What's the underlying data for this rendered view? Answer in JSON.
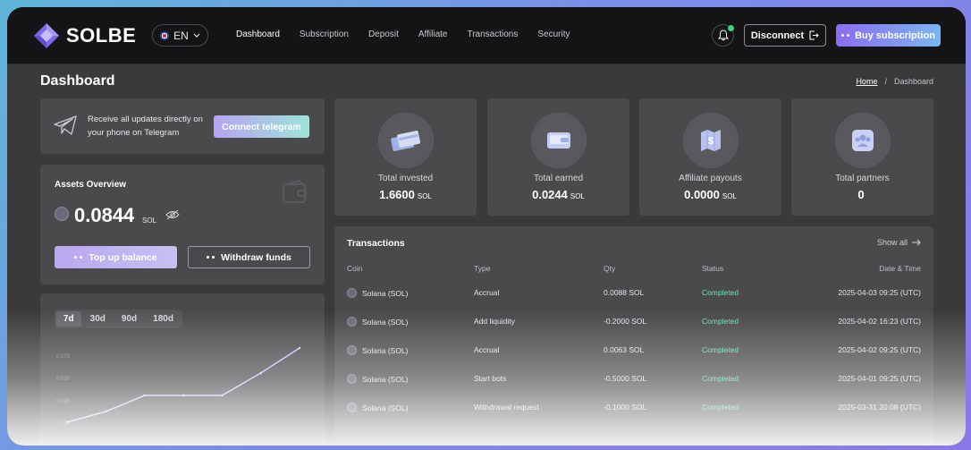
{
  "brand": {
    "name": "SOLBE"
  },
  "language": {
    "selected": "EN"
  },
  "nav": [
    {
      "label": "Dashboard",
      "active": true
    },
    {
      "label": "Subscription",
      "active": false
    },
    {
      "label": "Deposit",
      "active": false
    },
    {
      "label": "Affiliate",
      "active": false
    },
    {
      "label": "Transactions",
      "active": false
    },
    {
      "label": "Security",
      "active": false
    }
  ],
  "header": {
    "disconnect_label": "Disconnect",
    "buy_label": "Buy subscription"
  },
  "page": {
    "title": "Dashboard",
    "breadcrumb_home": "Home",
    "breadcrumb_sep": "/",
    "breadcrumb_current": "Dashboard"
  },
  "telegram": {
    "text": "Receive all updates directly on your phone on Telegram",
    "button": "Connect telegram"
  },
  "assets": {
    "title": "Assets Overview",
    "balance": "0.0844",
    "unit": "SOL",
    "topup_label": "Top up balance",
    "withdraw_label": "Withdraw funds"
  },
  "chart": {
    "tabs": [
      "7d",
      "30d",
      "90d",
      "180d"
    ],
    "active_tab": "7d"
  },
  "chart_data": {
    "type": "line",
    "ytick_labels": [
      "0.075",
      "0.050",
      "0.025",
      "0.000"
    ],
    "points": [
      0.0,
      0.012,
      0.03,
      0.03,
      0.03,
      0.055,
      0.083
    ],
    "ylim": [
      -0.02,
      0.09
    ],
    "xlabel": "",
    "ylabel": ""
  },
  "stats": [
    {
      "label": "Total invested",
      "value": "1.6600",
      "unit": "SOL",
      "icon": "cards-icon"
    },
    {
      "label": "Total earned",
      "value": "0.0244",
      "unit": "SOL",
      "icon": "wallet-card-icon"
    },
    {
      "label": "Affiliate payouts",
      "value": "0.0000",
      "unit": "SOL",
      "icon": "dollar-map-icon"
    },
    {
      "label": "Total partners",
      "value": "0",
      "unit": "",
      "icon": "users-icon"
    }
  ],
  "transactions": {
    "title": "Transactions",
    "show_all": "Show all",
    "columns": [
      "Coin",
      "Type",
      "Qty",
      "Status",
      "Date & Time"
    ],
    "rows": [
      {
        "coin": "Solana (SOL)",
        "type": "Accrual",
        "qty": "0.0088 SOL",
        "status": "Completed",
        "date": "2025-04-03 09:25 (UTC)"
      },
      {
        "coin": "Solana (SOL)",
        "type": "Add liquidity",
        "qty": "-0.2000 SOL",
        "status": "Completed",
        "date": "2025-04-02 16:23 (UTC)"
      },
      {
        "coin": "Solana (SOL)",
        "type": "Accrual",
        "qty": "0.0063 SOL",
        "status": "Completed",
        "date": "2025-04-02 09:25 (UTC)"
      },
      {
        "coin": "Solana (SOL)",
        "type": "Start bots",
        "qty": "-0.5000 SOL",
        "status": "Completed",
        "date": "2025-04-01 09:25 (UTC)"
      },
      {
        "coin": "Solana (SOL)",
        "type": "Withdrawal request",
        "qty": "-0.1000 SOL",
        "status": "Completed",
        "date": "2025-03-31 20:08 (UTC)"
      }
    ]
  },
  "colors": {
    "accent_start": "#8b6cf0",
    "accent_end": "#7ab6f0",
    "status_completed": "#6fe0b2",
    "notification_dot": "#3bd47a"
  }
}
